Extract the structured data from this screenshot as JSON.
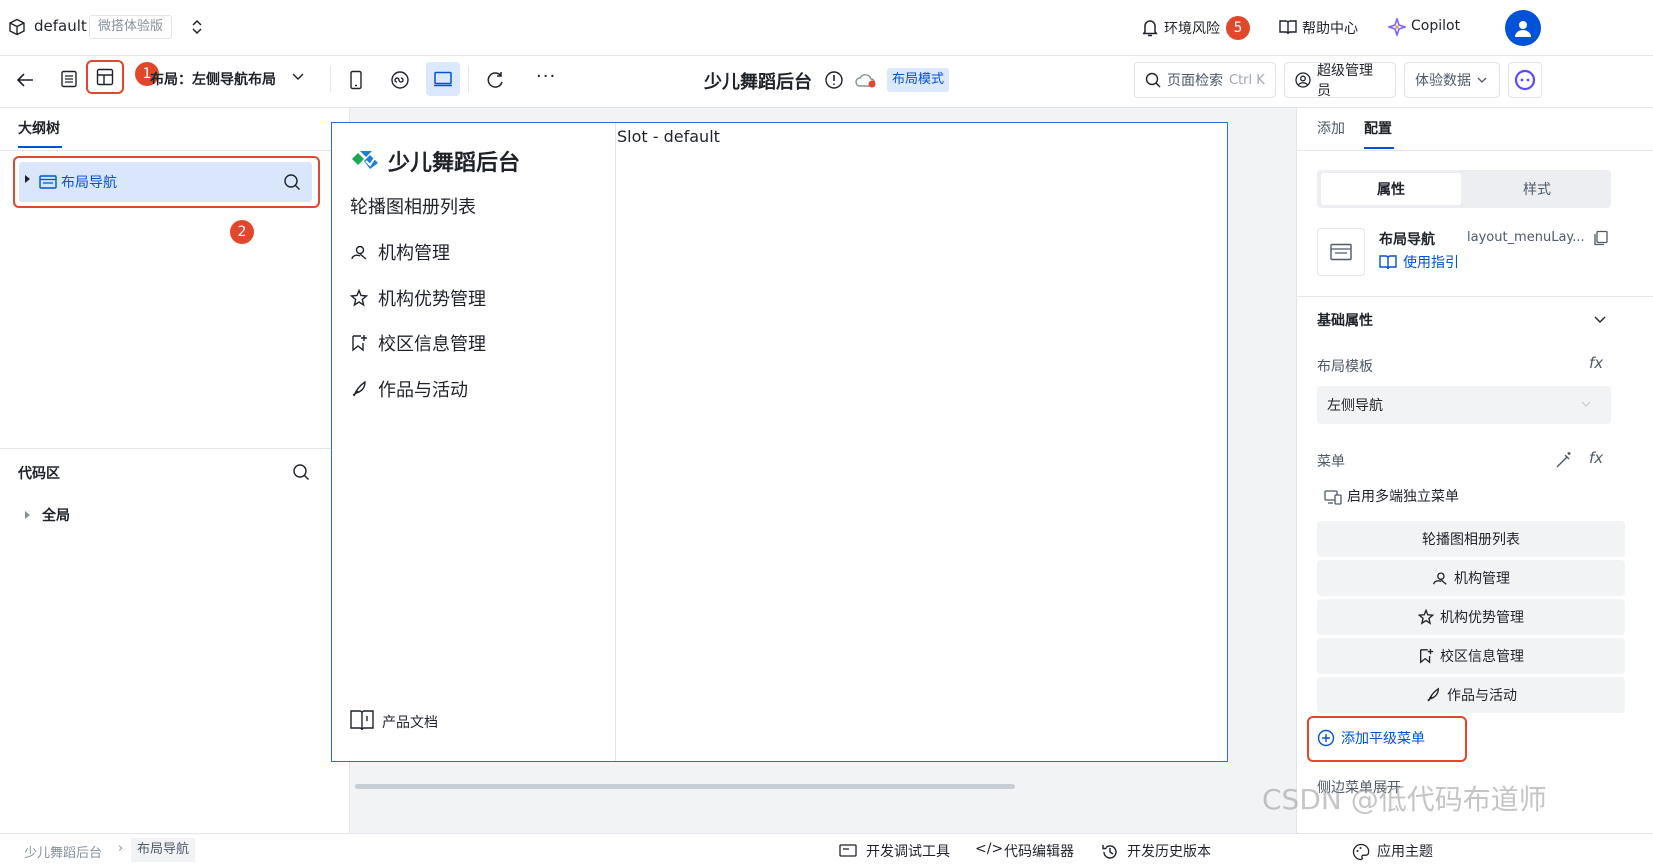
{
  "topbar": {
    "app_name": "default",
    "edition_badge": "微搭体验版",
    "env_risk_label": "环境风险",
    "env_risk_count": "5",
    "help_label": "帮助中心",
    "copilot_label": "Copilot"
  },
  "toolbar": {
    "layout_label": "布局：左侧导航布局",
    "page_title": "少儿舞蹈后台",
    "layout_mode_tag": "布局模式",
    "search_label": "页面检索",
    "search_shortcut": "Ctrl K",
    "role_label": "超级管理员",
    "data_label": "体验数据"
  },
  "annotations": {
    "step1": "1",
    "step2": "2"
  },
  "outline": {
    "tab_label": "大纲树",
    "node_label": "布局导航"
  },
  "code_area": {
    "title": "代码区",
    "global_label": "全局"
  },
  "preview": {
    "brand": "少儿舞蹈后台",
    "slot_label": "Slot - default",
    "menu": [
      "轮播图相册列表",
      "机构管理",
      "机构优势管理",
      "校区信息管理",
      "作品与活动"
    ],
    "footer_doc": "产品文档"
  },
  "right": {
    "tab_add": "添加",
    "tab_config": "配置",
    "seg_props": "属性",
    "seg_style": "样式",
    "comp_name": "布局导航",
    "comp_id": "layout_menuLay...",
    "guide_link": "使用指引",
    "section_basic": "基础属性",
    "layout_template_label": "布局模板",
    "layout_template_value": "左侧导航",
    "menu_label": "菜单",
    "multi_menu_label": "启用多端独立菜单",
    "menu_items": [
      "轮播图相册列表",
      "机构管理",
      "机构优势管理",
      "校区信息管理",
      "作品与活动"
    ],
    "add_menu": "添加平级菜单",
    "side_menu_expand": "侧边菜单展开"
  },
  "bottombar": {
    "crumb_root": "少儿舞蹈后台",
    "crumb_current": "布局导航",
    "devtools": "开发调试工具",
    "code_editor": "代码编辑器",
    "history": "开发历史版本",
    "theme": "应用主题"
  },
  "watermark": "CSDN @低代码布道师",
  "colors": {
    "accent": "#0052d9",
    "annotation_red": "#e2472c",
    "selected_bg": "#d9e6fb",
    "tag_bg": "#dbe8fd"
  }
}
